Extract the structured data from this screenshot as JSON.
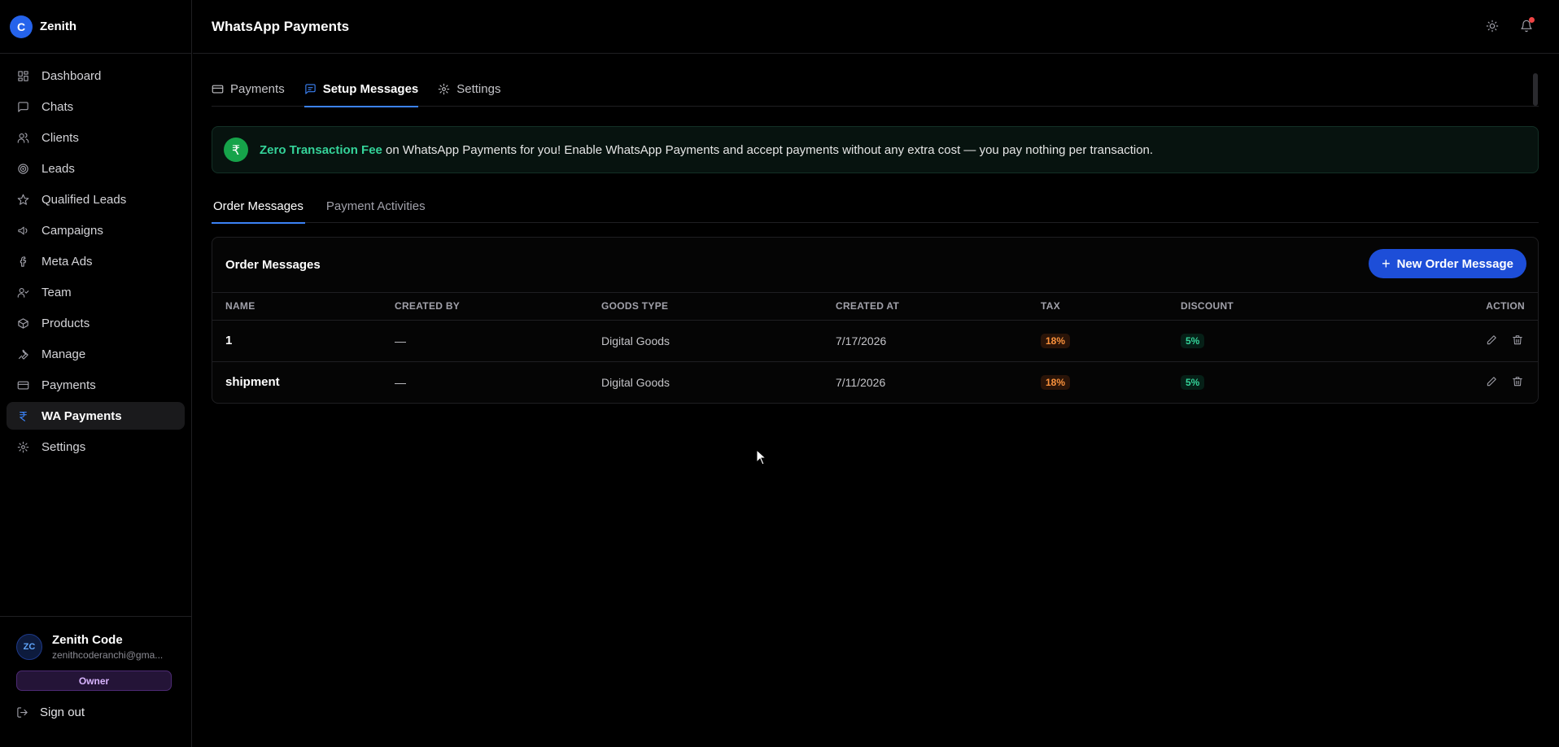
{
  "brand": {
    "initial": "C",
    "name": "Zenith"
  },
  "sidebar": {
    "items": [
      {
        "label": "Dashboard",
        "icon": "grid-icon"
      },
      {
        "label": "Chats",
        "icon": "chat-icon"
      },
      {
        "label": "Clients",
        "icon": "users-icon"
      },
      {
        "label": "Leads",
        "icon": "target-icon"
      },
      {
        "label": "Qualified Leads",
        "icon": "star-icon"
      },
      {
        "label": "Campaigns",
        "icon": "megaphone-icon"
      },
      {
        "label": "Meta Ads",
        "icon": "facebook-icon"
      },
      {
        "label": "Team",
        "icon": "user-check-icon"
      },
      {
        "label": "Products",
        "icon": "box-icon"
      },
      {
        "label": "Manage",
        "icon": "wrench-icon"
      },
      {
        "label": "Payments",
        "icon": "card-icon"
      },
      {
        "label": "WA Payments",
        "icon": "rupee-icon",
        "active": true
      },
      {
        "label": "Settings",
        "icon": "gear-icon"
      }
    ]
  },
  "user": {
    "initials": "ZC",
    "name": "Zenith Code",
    "email": "zenithcoderanchi@gma...",
    "role": "Owner",
    "signout_label": "Sign out"
  },
  "header": {
    "title": "WhatsApp Payments"
  },
  "tabs": [
    {
      "label": "Payments",
      "icon": "card-icon"
    },
    {
      "label": "Setup Messages",
      "icon": "message-icon",
      "active": true
    },
    {
      "label": "Settings",
      "icon": "gear-icon"
    }
  ],
  "promo": {
    "icon_glyph": "₹",
    "strong": "Zero Transaction Fee",
    "text": " on WhatsApp Payments for you! Enable WhatsApp Payments and accept payments without any extra cost — you pay nothing per transaction."
  },
  "subtabs": [
    {
      "label": "Order Messages",
      "active": true
    },
    {
      "label": "Payment Activities"
    }
  ],
  "card": {
    "title": "Order Messages",
    "new_button": "New Order Message",
    "columns": [
      "NAME",
      "CREATED BY",
      "GOODS TYPE",
      "CREATED AT",
      "TAX",
      "DISCOUNT",
      "ACTION"
    ],
    "rows": [
      {
        "name": "1",
        "created_by": "—",
        "goods_type": "Digital Goods",
        "created_at": "7/17/2026",
        "tax": "18%",
        "discount": "5%"
      },
      {
        "name": "shipment",
        "created_by": "—",
        "goods_type": "Digital Goods",
        "created_at": "7/11/2026",
        "tax": "18%",
        "discount": "5%"
      }
    ]
  },
  "colors": {
    "accent": "#3b82f6",
    "primary_button": "#1d4ed8",
    "promo_green": "#34d399",
    "tax_orange": "#fb923c"
  }
}
